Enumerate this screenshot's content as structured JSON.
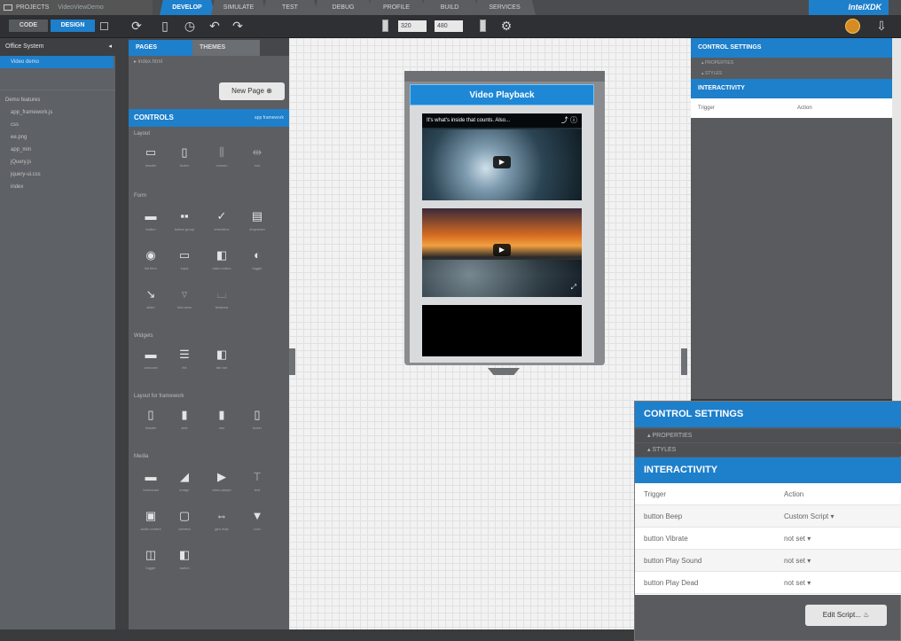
{
  "topbar": {
    "projects_label": "PROJECTS",
    "project_name": "VideoViewDemo",
    "tabs": [
      "DEVELOP",
      "SIMULATE",
      "TEST",
      "DEBUG",
      "PROFILE",
      "BUILD",
      "SERVICES"
    ],
    "active_tab": "DEVELOP",
    "brand": "IntelXDK"
  },
  "toolbar": {
    "code_label": "CODE",
    "design_label": "DESIGN",
    "width_value": "320",
    "height_value": "480"
  },
  "left": {
    "header": "Office System",
    "selected": "Video demo",
    "section": "Demo features",
    "items": [
      "app_framework.js",
      "css",
      "ee.png",
      "app_min",
      "jQuery.js",
      "jquery-ui.css",
      "index"
    ]
  },
  "mid": {
    "tab_pages": "PAGES",
    "tab_themes": "THEMES",
    "page_row": "index.html",
    "new_page": "New Page",
    "controls_title": "CONTROLS",
    "controls_right": "app framework",
    "groups": [
      {
        "title": "Layout",
        "cells": [
          "header",
          "footer",
          "column",
          "row"
        ]
      },
      {
        "title": "Form",
        "cells": [
          "button",
          "button group",
          "checkbox",
          "dropdown",
          "list item",
          "input",
          "radio button",
          "toggle",
          "slider",
          "text area",
          "textarea"
        ]
      },
      {
        "title": "Widgets",
        "cells": [
          "carousel",
          "list",
          "tab bar"
        ]
      },
      {
        "title": "Layout for framework",
        "cells": [
          "header",
          "side",
          "nav",
          "footer"
        ]
      },
      {
        "title": "Media",
        "cells": [
          "horizontal",
          "image",
          "video player",
          "text",
          "audio control",
          "camera",
          "geo map",
          "icon",
          "toggle",
          "switch"
        ]
      }
    ]
  },
  "phone": {
    "title": "Video Playback",
    "video1_caption": "It's what's inside that counts. Also...",
    "video2_caption": ""
  },
  "right": {
    "control_settings": "CONTROL SETTINGS",
    "properties": "PROPERTIES",
    "styles": "STYLES",
    "interactivity": "INTERACTIVITY",
    "trigger": "Trigger",
    "action": "Action"
  },
  "zoom": {
    "control_settings": "CONTROL SETTINGS",
    "properties": "PROPERTIES",
    "styles": "STYLES",
    "interactivity": "INTERACTIVITY",
    "header_trigger": "Trigger",
    "header_action": "Action",
    "rows": [
      {
        "trigger": "button Beep",
        "action": "Custom Script"
      },
      {
        "trigger": "button Vibrate",
        "action": "not set"
      },
      {
        "trigger": "button Play Sound",
        "action": "not set"
      },
      {
        "trigger": "button Play Dead",
        "action": "not set"
      }
    ],
    "edit_script": "Edit Script..."
  },
  "colors": {
    "accent": "#1e7fcb",
    "panel": "#5c5e62",
    "canvas": "#f2f2f2"
  }
}
